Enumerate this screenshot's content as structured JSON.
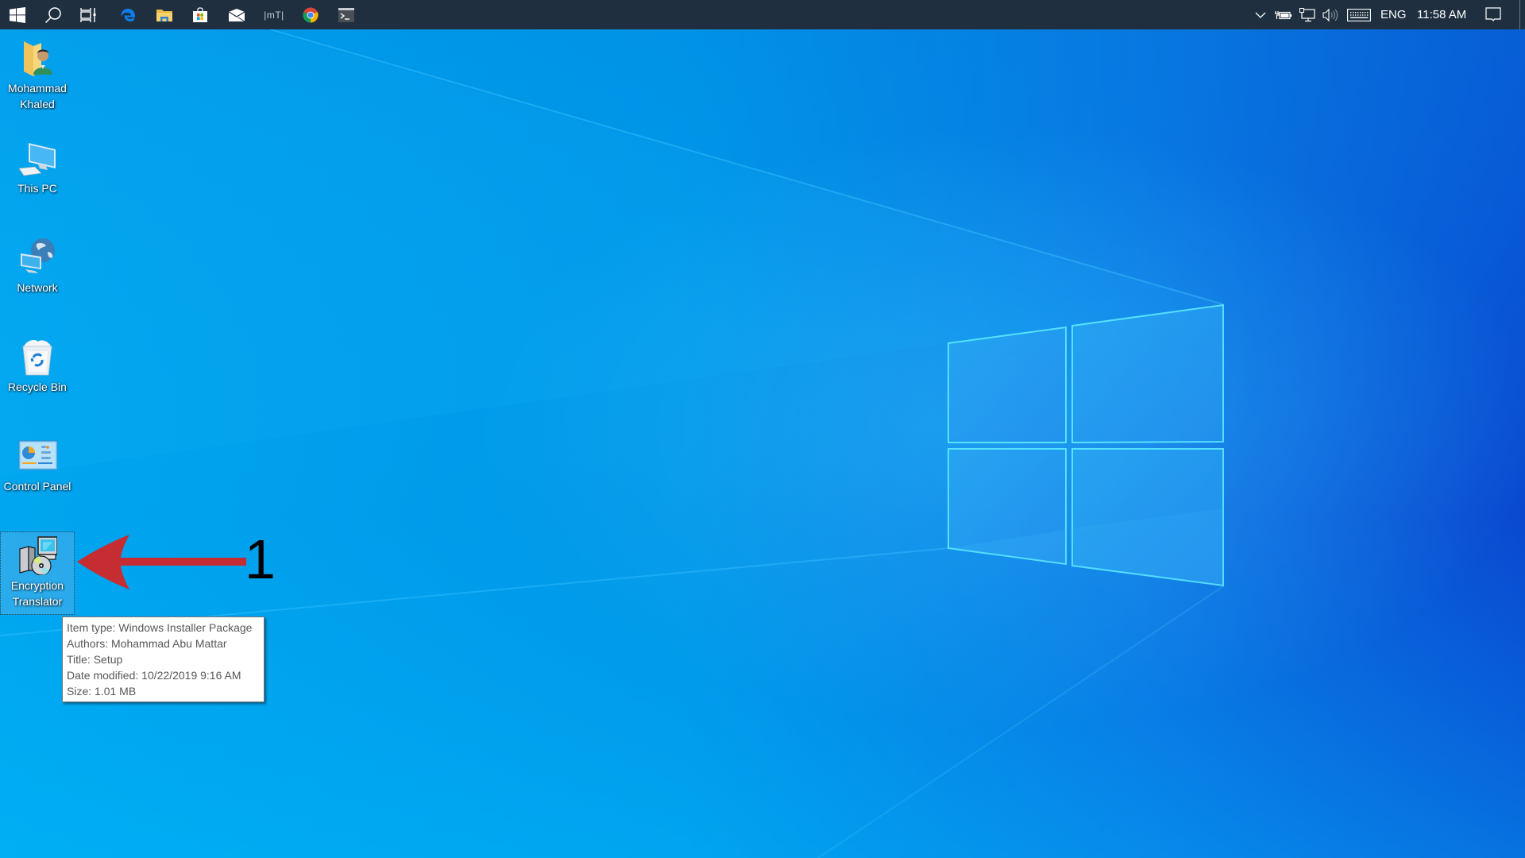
{
  "wallpaper": {
    "colors": {
      "top_left": "#0098e8",
      "bottom_left": "#00b4f8",
      "right": "#0a4fd4",
      "logo_pane": "#2aa8f4",
      "logo_edge": "#5ff0ff"
    }
  },
  "taskbar": {
    "background": "#1f2f3f",
    "pinned": [
      {
        "name": "start-button",
        "icon": "windows-logo-icon",
        "label": "Start"
      },
      {
        "name": "search-button",
        "icon": "search-icon",
        "label": "Search"
      },
      {
        "name": "task-view-button",
        "icon": "task-view-icon",
        "label": "Task View"
      },
      {
        "name": "edge-button",
        "icon": "edge-icon",
        "label": "Microsoft Edge"
      },
      {
        "name": "file-explorer-button",
        "icon": "folder-icon",
        "label": "File Explorer"
      },
      {
        "name": "store-button",
        "icon": "store-icon",
        "label": "Microsoft Store"
      },
      {
        "name": "mail-button",
        "icon": "mail-icon",
        "label": "Mail"
      },
      {
        "name": "mt-button",
        "icon": "mt-icon",
        "label": "|mT|"
      },
      {
        "name": "chrome-button",
        "icon": "chrome-icon",
        "label": "Google Chrome"
      },
      {
        "name": "terminal-button",
        "icon": "terminal-icon",
        "label": "Command Prompt"
      }
    ],
    "tray": {
      "language": "ENG",
      "time": "11:58 AM"
    }
  },
  "desktop": {
    "icons": [
      {
        "label_line1": "Mohammad",
        "label_line2": "Khaled",
        "icon": "user-folder-icon"
      },
      {
        "label_line1": "This PC",
        "label_line2": "",
        "icon": "this-pc-icon"
      },
      {
        "label_line1": "Network",
        "label_line2": "",
        "icon": "network-icon"
      },
      {
        "label_line1": "Recycle Bin",
        "label_line2": "",
        "icon": "recycle-bin-icon"
      },
      {
        "label_line1": "Control Panel",
        "label_line2": "",
        "icon": "control-panel-icon"
      },
      {
        "label_line1": "Encryption",
        "label_line2": "Translator",
        "icon": "installer-package-icon",
        "selected": true
      }
    ]
  },
  "tooltip": {
    "lines": [
      "Item type: Windows Installer Package",
      "Authors: Mohammad Abu Mattar",
      "Title: Setup",
      "Date modified: 10/22/2019 9:16 AM",
      "Size: 1.01 MB"
    ]
  },
  "annotation": {
    "step_number": "1",
    "arrow_color": "#c62d32"
  }
}
